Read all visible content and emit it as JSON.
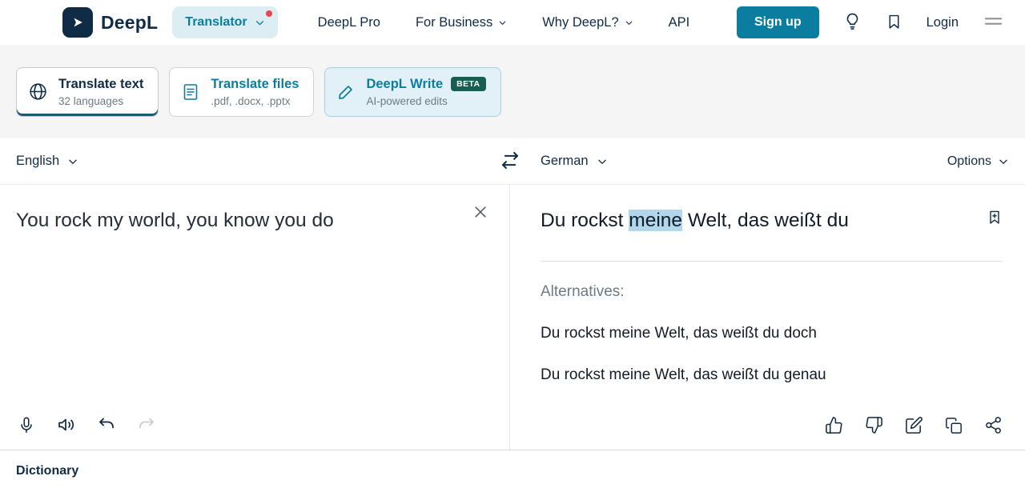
{
  "colors": {
    "accent_teal": "#0b7d9e",
    "brand_navy": "#0f2b46",
    "highlight_blue": "#b2d7ea",
    "beta_badge_green": "#175e50",
    "notification_red": "#e5484d"
  },
  "header": {
    "brand": "DeepL",
    "translator_label": "Translator",
    "nav": [
      {
        "label": "DeepL Pro"
      },
      {
        "label": "For Business"
      },
      {
        "label": "Why DeepL?"
      },
      {
        "label": "API"
      }
    ],
    "signup_label": "Sign up",
    "login_label": "Login"
  },
  "tabs": [
    {
      "title": "Translate text",
      "subtitle": "32 languages"
    },
    {
      "title": "Translate files",
      "subtitle": ".pdf, .docx, .pptx"
    },
    {
      "title": "DeepL Write",
      "subtitle": "AI-powered edits",
      "badge": "BETA"
    }
  ],
  "language_bar": {
    "source_language": "English",
    "target_language": "German",
    "options_label": "Options"
  },
  "source_panel": {
    "text": "You rock my world, you know you do"
  },
  "target_panel": {
    "text_before": "Du rockst ",
    "text_highlight": "meine",
    "text_after": " Welt, das weißt du",
    "alternatives_label": "Alternatives:",
    "alternatives": [
      "Du rockst meine Welt, das weißt du doch",
      "Du rockst meine Welt, das weißt du genau"
    ]
  },
  "footer": {
    "dictionary_label": "Dictionary"
  }
}
